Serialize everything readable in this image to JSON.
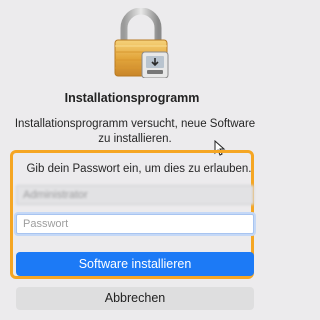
{
  "dialog": {
    "icon": "lock-installer-icon",
    "title": "Installationsprogramm",
    "message": "Installationsprogramm versucht, neue Software zu installieren.",
    "prompt": "Gib dein Passwort ein, um dies zu erlauben.",
    "username_value": "Administrator",
    "password_placeholder": "Passwort",
    "primary_button_label": "Software installieren",
    "secondary_button_label": "Abbrechen"
  },
  "colors": {
    "highlight": "#f5a623",
    "primary_button": "#1c7af6",
    "background": "#ecebed"
  }
}
